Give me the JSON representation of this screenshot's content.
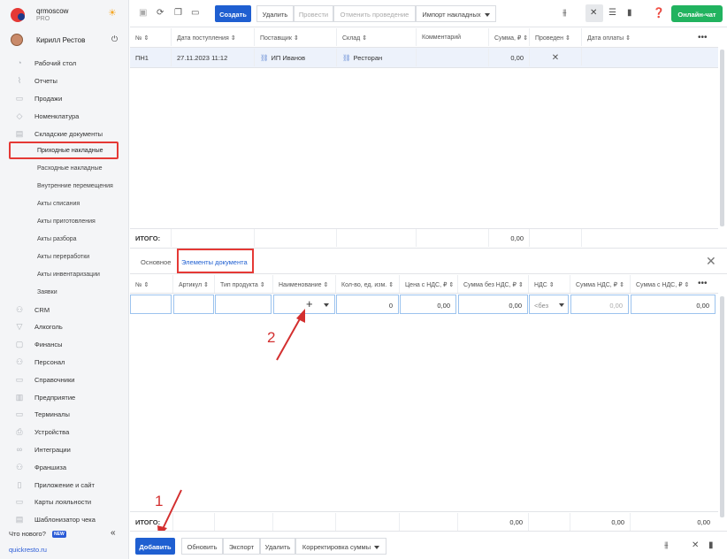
{
  "account": {
    "name": "qrmoscow",
    "plan": "PRO"
  },
  "user": {
    "name": "Кирилл Рестов"
  },
  "sidebar": {
    "items": [
      {
        "label": "Рабочий стол",
        "icon": "dashboard-icon"
      },
      {
        "label": "Отчеты",
        "icon": "chart-icon"
      },
      {
        "label": "Продажи",
        "icon": "cart-icon"
      },
      {
        "label": "Номенклатура",
        "icon": "tag-icon"
      },
      {
        "label": "Складские документы",
        "icon": "warehouse-icon"
      }
    ],
    "subitems": [
      "Приходные накладные",
      "Расходные накладные",
      "Внутренние перемещения",
      "Акты списания",
      "Акты приготовления",
      "Акты разбора",
      "Акты переработки",
      "Акты инвентаризации",
      "Заявки"
    ],
    "items2": [
      {
        "label": "CRM",
        "icon": "crm-icon"
      },
      {
        "label": "Алкоголь",
        "icon": "glass-icon"
      },
      {
        "label": "Финансы",
        "icon": "wallet-icon"
      },
      {
        "label": "Персонал",
        "icon": "people-icon"
      },
      {
        "label": "Справочники",
        "icon": "book-icon"
      },
      {
        "label": "Предприятие",
        "icon": "building-icon"
      },
      {
        "label": "Терминалы",
        "icon": "terminal-icon"
      },
      {
        "label": "Устройства",
        "icon": "printer-icon"
      },
      {
        "label": "Интеграции",
        "icon": "link-icon"
      },
      {
        "label": "Франшиза",
        "icon": "franchise-icon"
      },
      {
        "label": "Приложение и сайт",
        "icon": "app-icon"
      },
      {
        "label": "Карты лояльности",
        "icon": "card-icon"
      },
      {
        "label": "Шаблонизатор чека",
        "icon": "receipt-icon"
      }
    ],
    "whats_new": "Что нового?",
    "new_badge": "NEW",
    "site": "quickresto.ru"
  },
  "toolbar": {
    "create": "Создать",
    "delete": "Удалить",
    "post": "Провести",
    "unpost": "Отменить проведение",
    "import": "Импорт накладных",
    "chat": "Онлайн-чат"
  },
  "doc_table": {
    "headers": [
      "№",
      "Дата поступления",
      "Поставщик",
      "Склад",
      "Комментарий",
      "Сумма, ₽",
      "Проведен",
      "Дата оплаты"
    ],
    "rows": [
      {
        "num": "ПН1",
        "date": "27.11.2023 11:12",
        "supplier": "ИП Иванов",
        "warehouse": "Ресторан",
        "comment": "",
        "sum": "0,00",
        "posted": "✕",
        "paid": ""
      }
    ],
    "total_label": "ИТОГО:",
    "total_sum": "0,00"
  },
  "tabs": {
    "basic": "Основное",
    "elements": "Элементы документа"
  },
  "items_table": {
    "headers": [
      "№",
      "Артикул",
      "Тип продукта",
      "Наименование",
      "Кол-во, ед. изм.",
      "Цена с НДС, ₽",
      "Сумма без НДС, ₽",
      "НДС",
      "Сумма НДС, ₽",
      "Сумма с НДС, ₽"
    ],
    "row": {
      "qty": "0",
      "price": "0,00",
      "sum_no_vat": "0,00",
      "vat": "<без",
      "vat_sum": "0,00",
      "sum_vat": "0,00"
    },
    "total_label": "ИТОГО:",
    "totals": {
      "sum_no_vat": "0,00",
      "vat_sum": "0,00",
      "sum_vat": "0,00"
    }
  },
  "annotations": {
    "one": "1",
    "two": "2"
  },
  "bottombar": {
    "add": "Добавить",
    "refresh": "Обновить",
    "export": "Экспорт",
    "delete": "Удалить",
    "correction": "Корректировка суммы"
  }
}
